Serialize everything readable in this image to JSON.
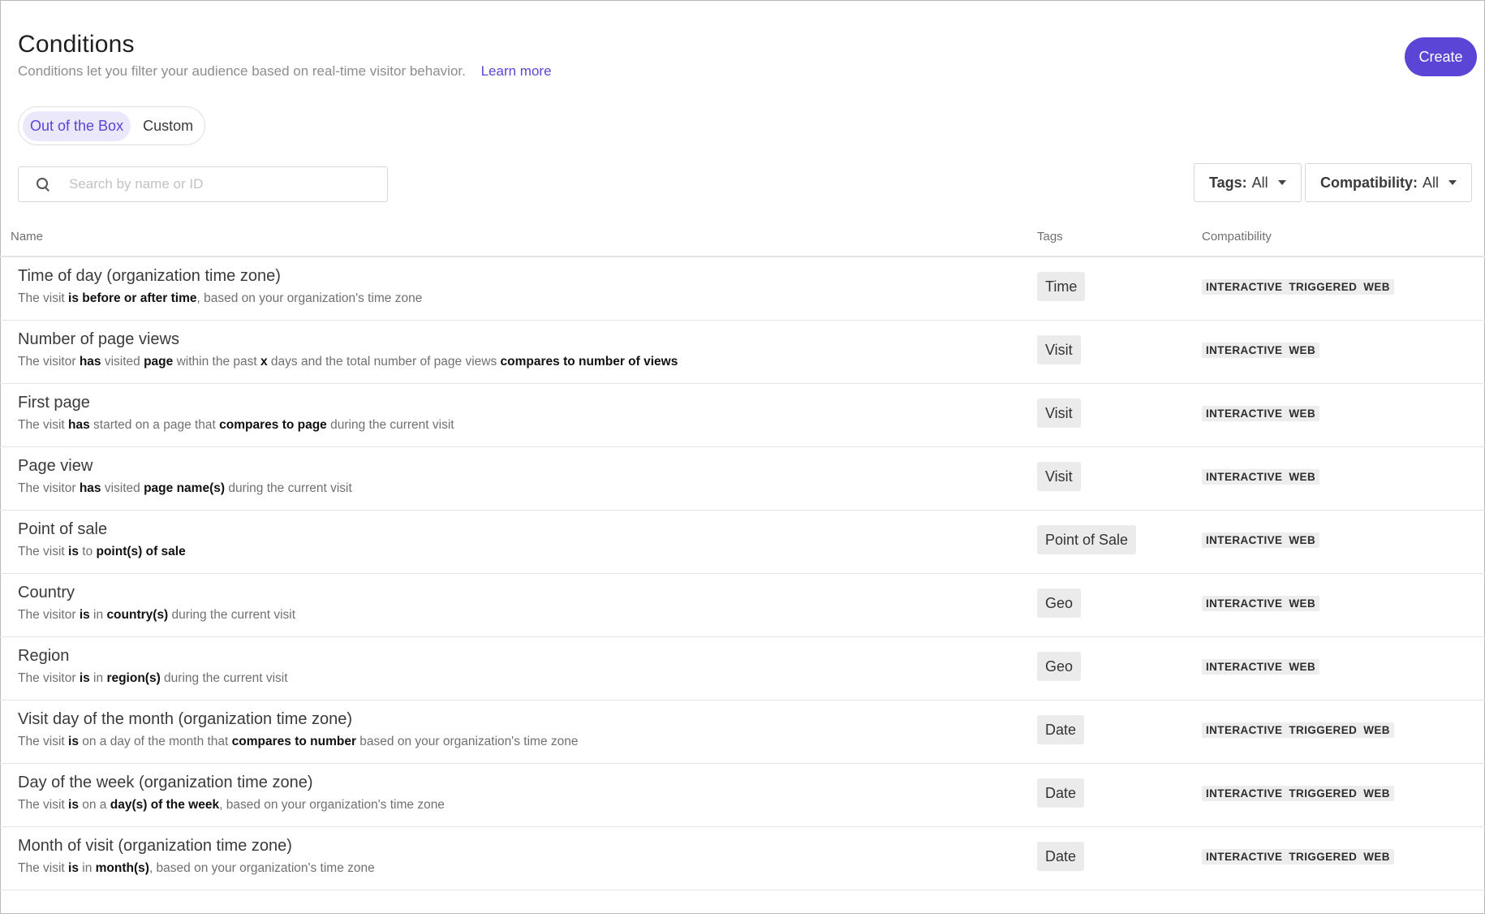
{
  "header": {
    "title": "Conditions",
    "subtitle": "Conditions let you filter your audience based on real-time visitor behavior.",
    "learn_more": "Learn more"
  },
  "create_label": "Create",
  "toggle": {
    "out_of_box": "Out of the Box",
    "custom": "Custom"
  },
  "search": {
    "placeholder": "Search by name or ID"
  },
  "filters": {
    "tags_label": "Tags:",
    "tags_value": "All",
    "compat_label": "Compatibility:",
    "compat_value": "All"
  },
  "columns": {
    "name": "Name",
    "tags": "Tags",
    "compat": "Compatibility"
  },
  "rows": [
    {
      "name": "Time of day (organization time zone)",
      "desc": [
        [
          "The visit ",
          false
        ],
        [
          "is before or after time",
          true
        ],
        [
          ", based on your organization's time zone",
          false
        ]
      ],
      "tag": "Time",
      "compat": [
        "INTERACTIVE",
        "TRIGGERED",
        "WEB"
      ]
    },
    {
      "name": "Number of page views",
      "desc": [
        [
          "The visitor ",
          false
        ],
        [
          "has",
          true
        ],
        [
          " visited ",
          false
        ],
        [
          "page",
          true
        ],
        [
          " within the past ",
          false
        ],
        [
          "x",
          true
        ],
        [
          " days and the total number of page views ",
          false
        ],
        [
          "compares to number of views",
          true
        ]
      ],
      "tag": "Visit",
      "compat": [
        "INTERACTIVE",
        "WEB"
      ]
    },
    {
      "name": "First page",
      "desc": [
        [
          "The visit ",
          false
        ],
        [
          "has",
          true
        ],
        [
          " started on a page that ",
          false
        ],
        [
          "compares to page",
          true
        ],
        [
          " during the current visit",
          false
        ]
      ],
      "tag": "Visit",
      "compat": [
        "INTERACTIVE",
        "WEB"
      ]
    },
    {
      "name": "Page view",
      "desc": [
        [
          "The visitor ",
          false
        ],
        [
          "has",
          true
        ],
        [
          " visited ",
          false
        ],
        [
          "page name(s)",
          true
        ],
        [
          " during the current visit",
          false
        ]
      ],
      "tag": "Visit",
      "compat": [
        "INTERACTIVE",
        "WEB"
      ]
    },
    {
      "name": "Point of sale",
      "desc": [
        [
          "The visit ",
          false
        ],
        [
          "is",
          true
        ],
        [
          " to ",
          false
        ],
        [
          "point(s) of sale",
          true
        ]
      ],
      "tag": "Point of Sale",
      "compat": [
        "INTERACTIVE",
        "WEB"
      ]
    },
    {
      "name": "Country",
      "desc": [
        [
          "The visitor ",
          false
        ],
        [
          "is",
          true
        ],
        [
          " in ",
          false
        ],
        [
          "country(s)",
          true
        ],
        [
          " during the current visit",
          false
        ]
      ],
      "tag": "Geo",
      "compat": [
        "INTERACTIVE",
        "WEB"
      ]
    },
    {
      "name": "Region",
      "desc": [
        [
          "The visitor ",
          false
        ],
        [
          "is",
          true
        ],
        [
          " in ",
          false
        ],
        [
          "region(s)",
          true
        ],
        [
          " during the current visit",
          false
        ]
      ],
      "tag": "Geo",
      "compat": [
        "INTERACTIVE",
        "WEB"
      ]
    },
    {
      "name": "Visit day of the month (organization time zone)",
      "desc": [
        [
          "The visit ",
          false
        ],
        [
          "is",
          true
        ],
        [
          " on a day of the month that ",
          false
        ],
        [
          "compares to number",
          true
        ],
        [
          " based on your organization's time zone",
          false
        ]
      ],
      "tag": "Date",
      "compat": [
        "INTERACTIVE",
        "TRIGGERED",
        "WEB"
      ]
    },
    {
      "name": "Day of the week (organization time zone)",
      "desc": [
        [
          "The visit ",
          false
        ],
        [
          "is",
          true
        ],
        [
          " on a ",
          false
        ],
        [
          "day(s) of the week",
          true
        ],
        [
          ", based on your organization's time zone",
          false
        ]
      ],
      "tag": "Date",
      "compat": [
        "INTERACTIVE",
        "TRIGGERED",
        "WEB"
      ]
    },
    {
      "name": "Month of visit (organization time zone)",
      "desc": [
        [
          "The visit ",
          false
        ],
        [
          "is",
          true
        ],
        [
          " in ",
          false
        ],
        [
          "month(s)",
          true
        ],
        [
          ", based on your organization's time zone",
          false
        ]
      ],
      "tag": "Date",
      "compat": [
        "INTERACTIVE",
        "TRIGGERED",
        "WEB"
      ]
    }
  ]
}
